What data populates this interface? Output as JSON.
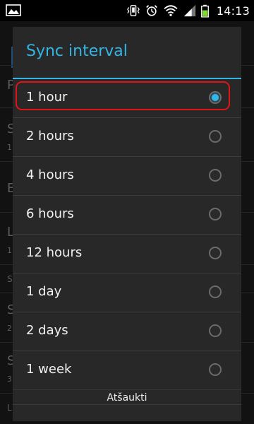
{
  "status_bar": {
    "time": "14:13",
    "icons": [
      "image-icon",
      "vibrate-icon",
      "alarm-icon",
      "wifi-icon",
      "signal-icon",
      "battery-icon"
    ]
  },
  "dialog": {
    "title": "Sync interval",
    "options": [
      {
        "label": "1 hour",
        "selected": true
      },
      {
        "label": "2 hours",
        "selected": false
      },
      {
        "label": "4 hours",
        "selected": false
      },
      {
        "label": "6 hours",
        "selected": false
      },
      {
        "label": "12 hours",
        "selected": false
      },
      {
        "label": "1 day",
        "selected": false
      },
      {
        "label": "2 days",
        "selected": false
      },
      {
        "label": "1 week",
        "selected": false
      }
    ],
    "cancel_label": "Atšaukti"
  },
  "colors": {
    "accent": "#33b5e5",
    "highlight": "#e01414",
    "dialog_bg": "#282828"
  }
}
